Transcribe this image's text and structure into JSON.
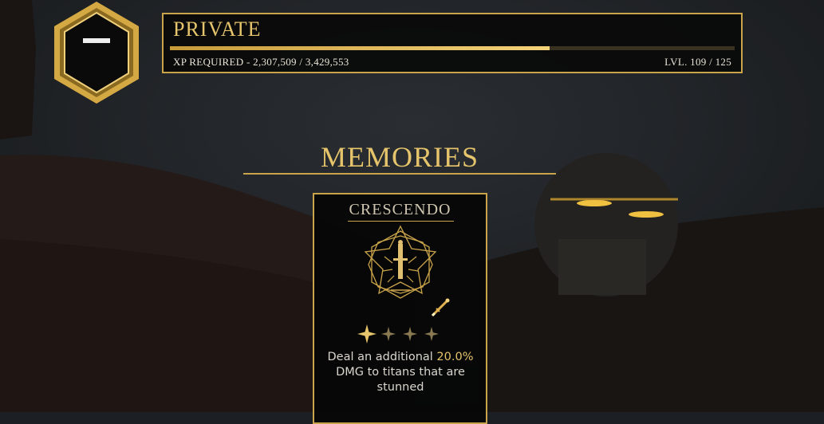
{
  "rank": {
    "name": "PRIVATE",
    "xp_label": "XP REQUIRED",
    "xp_current": "2,307,509",
    "xp_required": "3,429,553",
    "xp_fraction": 0.673,
    "level_text": "LVL. 109 / 125"
  },
  "memories": {
    "title": "MEMORIES",
    "card": {
      "name": "CRESCENDO",
      "stars_total": 4,
      "stars_filled": 1,
      "desc_pre": "Deal an additional ",
      "desc_value": "20.0%",
      "desc_post": " DMG to titans that are stunned",
      "icons": [
        "star-emblem-sword-icon",
        "sword-upgrade-icon"
      ]
    }
  },
  "colors": {
    "gold": "#c9a44a",
    "gold_text": "#e5c46b",
    "panel": "#080808"
  }
}
